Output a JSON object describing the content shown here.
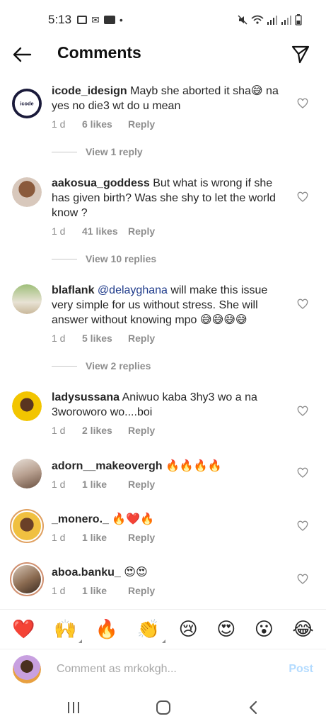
{
  "status_bar": {
    "time": "5:13"
  },
  "header": {
    "title": "Comments"
  },
  "comments": [
    {
      "username": "icode_idesign",
      "text": "Mayb she aborted it sha😅 na yes no die3 wt do u mean",
      "time": "1 d",
      "likes": "6 likes",
      "reply": "Reply",
      "view_replies": "View 1 reply",
      "avatar_label": "icode"
    },
    {
      "username": "aakosua_goddess",
      "text": "But what is wrong if she has given birth? Was she shy to let the world know ?",
      "time": "1 d",
      "likes": "41 likes",
      "reply": "Reply",
      "view_replies": "View 10 replies"
    },
    {
      "username": "blaflank",
      "mention": "@delayghana",
      "text": " will make this issue very simple for us without stress. She will answer without knowing mpo 😅😅😅😅",
      "time": "1 d",
      "likes": "5 likes",
      "reply": "Reply",
      "view_replies": "View 2 replies"
    },
    {
      "username": "ladysussana",
      "text": "Aniwuo kaba 3hy3 wo a na 3woroworo wo....boi",
      "time": "1 d",
      "likes": "2 likes",
      "reply": "Reply"
    },
    {
      "username": "adorn__makeovergh",
      "text": "🔥🔥🔥🔥",
      "time": "1 d",
      "likes": "1 like",
      "reply": "Reply"
    },
    {
      "username": "_monero._",
      "text": "🔥❤️🔥",
      "time": "1 d",
      "likes": "1 like",
      "reply": "Reply"
    },
    {
      "username": "aboa.banku_",
      "text": "😍😍",
      "time": "1 d",
      "likes": "1 like",
      "reply": "Reply"
    }
  ],
  "emoji_bar": [
    "❤️",
    "🙌",
    "🔥",
    "👏",
    "😢",
    "😍",
    "😮",
    "😂"
  ],
  "comment_input": {
    "placeholder": "Comment as mrkokgh...",
    "post_label": "Post"
  },
  "colors": {
    "post_disabled": "#b3dbff",
    "mention": "#1e3a8a",
    "meta": "#8e8e8e",
    "heart_red": "#ed4956"
  },
  "icons": {
    "back": "arrow-left-icon",
    "send": "paper-plane-icon",
    "heart": "heart-outline-icon"
  }
}
